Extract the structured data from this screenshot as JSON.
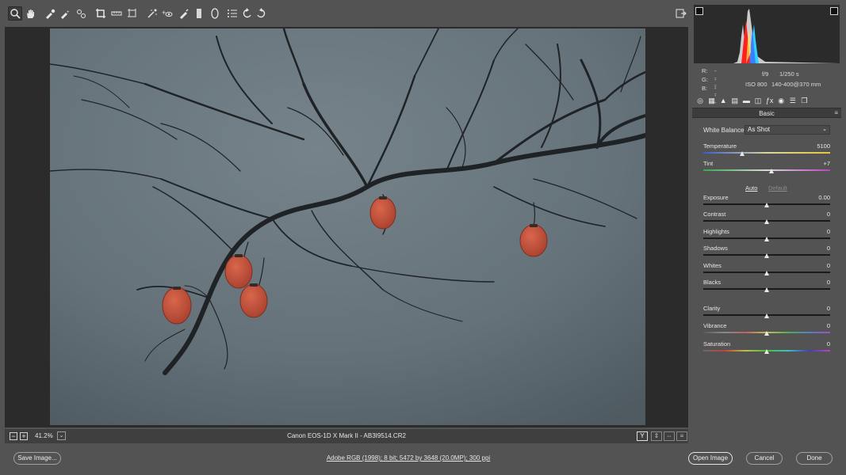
{
  "toolbar": {
    "tools": [
      {
        "name": "zoom-tool",
        "glyph": "zoom",
        "active": true
      },
      {
        "name": "hand-tool",
        "glyph": "hand"
      },
      {
        "name": "white-balance-tool",
        "glyph": "eyedropper"
      },
      {
        "name": "color-sampler-tool",
        "glyph": "sampler"
      },
      {
        "name": "targeted-adjustment-tool",
        "glyph": "target"
      },
      {
        "name": "crop-tool",
        "glyph": "crop"
      },
      {
        "name": "straighten-tool",
        "glyph": "straighten"
      },
      {
        "name": "transform-tool",
        "glyph": "transform"
      },
      {
        "name": "spot-removal-tool",
        "glyph": "spot"
      },
      {
        "name": "red-eye-tool",
        "glyph": "redeye"
      },
      {
        "name": "adjustment-brush-tool",
        "glyph": "brush"
      },
      {
        "name": "graduated-filter-tool",
        "glyph": "gradient"
      },
      {
        "name": "radial-filter-tool",
        "glyph": "radial"
      },
      {
        "name": "preferences-tool",
        "glyph": "list"
      },
      {
        "name": "rotate-ccw-tool",
        "glyph": "rotccw"
      },
      {
        "name": "rotate-cw-tool",
        "glyph": "rotcw"
      }
    ]
  },
  "status": {
    "zoom_minus": "−",
    "zoom_plus": "+",
    "zoom": "41.2%",
    "zoom_dropdown": "⌄",
    "file_title": "Canon EOS-1D X Mark II  -  AB3I9514.CR2",
    "view_buttons": [
      "Y",
      "⇕",
      "⇔",
      "≡"
    ]
  },
  "camera": {
    "r_label": "R:",
    "r_value": "---",
    "g_label": "G:",
    "g_value": "---",
    "b_label": "B:",
    "b_value": "---",
    "aperture": "f/9",
    "shutter": "1/250 s",
    "iso": "ISO 800",
    "lens": "140-400@370 mm"
  },
  "panel": {
    "tabs": [
      "◎",
      "▦",
      "▲",
      "▤",
      "▬",
      "◫",
      "ƒx",
      "◉",
      "☰",
      "❐"
    ],
    "title": "Basic",
    "menu": "≡",
    "white_balance_label": "White Balance:",
    "white_balance_value": "As Shot",
    "white_balance_chevron": "⌄",
    "auto": "Auto",
    "default": "Default",
    "sliders": [
      {
        "label": "Temperature",
        "value": "5100",
        "level": 0.31,
        "track": "temp"
      },
      {
        "label": "Tint",
        "value": "+7",
        "level": 0.54,
        "track": "tint"
      },
      {
        "label": "Exposure",
        "value": "0.00",
        "level": 0.5,
        "track": "plain"
      },
      {
        "label": "Contrast",
        "value": "0",
        "level": 0.5,
        "track": "plain"
      },
      {
        "label": "Highlights",
        "value": "0",
        "level": 0.5,
        "track": "plain"
      },
      {
        "label": "Shadows",
        "value": "0",
        "level": 0.5,
        "track": "plain"
      },
      {
        "label": "Whites",
        "value": "0",
        "level": 0.5,
        "track": "plain"
      },
      {
        "label": "Blacks",
        "value": "0",
        "level": 0.5,
        "track": "plain"
      },
      {
        "label": "Clarity",
        "value": "0",
        "level": 0.5,
        "track": "plain"
      },
      {
        "label": "Vibrance",
        "value": "0",
        "level": 0.5,
        "track": "vib"
      },
      {
        "label": "Saturation",
        "value": "0",
        "level": 0.5,
        "track": "sat"
      }
    ]
  },
  "footer": {
    "save_image": "Save Image...",
    "workflow": "Adobe RGB (1998); 8 bit; 5472 by 3648 (20.0MP); 300 ppi",
    "open_image": "Open Image",
    "cancel": "Cancel",
    "done": "Done"
  },
  "colors": {
    "background": "#535353",
    "canvas": "#2b2b2b",
    "photo_sky": "#66737a",
    "persimmon": "#c8533e"
  }
}
